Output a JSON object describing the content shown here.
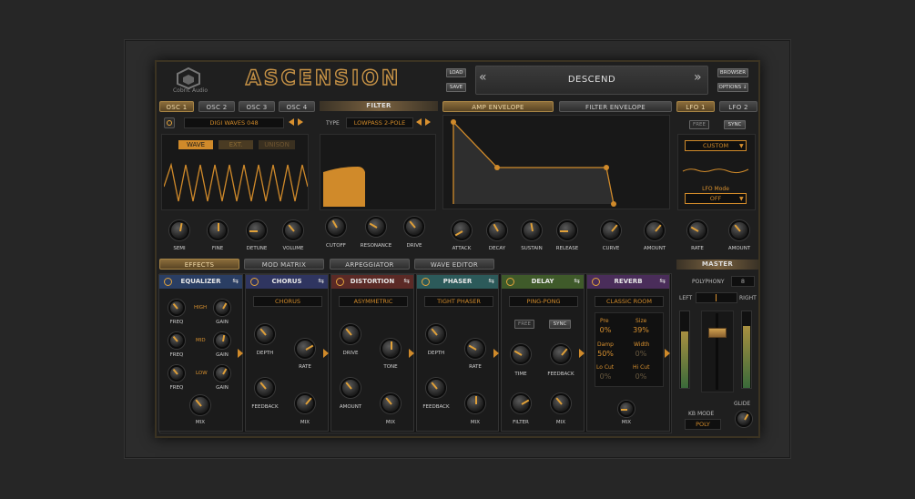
{
  "header": {
    "logo_text": "Cobric Audio",
    "title": "ASCENSION",
    "load": "LOAD",
    "save": "SAVE",
    "prev": "«",
    "next": "»",
    "preset": "DESCEND",
    "browser": "BROWSER",
    "options": "OPTIONS ↓"
  },
  "osc": {
    "tabs": [
      "OSC 1",
      "OSC 2",
      "OSC 3",
      "OSC 4"
    ],
    "waveform_name": "DIGI WAVES 048",
    "modes": [
      "WAVE",
      "EXT.",
      "UNISON"
    ],
    "knobs": [
      "SEMI",
      "FINE",
      "DETUNE",
      "VOLUME"
    ]
  },
  "filter": {
    "title": "FILTER",
    "type_label": "TYPE",
    "type_value": "LOWPASS 2-POLE",
    "knobs": [
      "CUTOFF",
      "RESONANCE",
      "DRIVE"
    ]
  },
  "envelope": {
    "tabs": [
      "AMP ENVELOPE",
      "FILTER ENVELOPE"
    ],
    "knobs": [
      "ATTACK",
      "DECAY",
      "SUSTAIN",
      "RELEASE",
      "CURVE",
      "AMOUNT"
    ]
  },
  "lfo": {
    "tabs": [
      "LFO 1",
      "LFO 2"
    ],
    "free": "FREE",
    "sync": "SYNC",
    "shape": "CUSTOM",
    "mode_label": "LFO Mode",
    "mode_value": "OFF",
    "knobs": [
      "RATE",
      "AMOUNT"
    ]
  },
  "section_tabs": [
    "EFFECTS",
    "MOD MATRIX",
    "ARPEGGIATOR",
    "WAVE EDITOR"
  ],
  "master": {
    "title": "MASTER",
    "polyphony_label": "POLYPHONY",
    "polyphony_value": "8",
    "left": "LEFT",
    "right": "RIGHT",
    "glide": "GLIDE",
    "kb_mode_label": "KB MODE",
    "kb_mode_value": "POLY"
  },
  "effects": {
    "equalizer": {
      "title": "EQUALIZER",
      "bands": [
        "HIGH",
        "MID",
        "LOW"
      ],
      "freq": "FREQ",
      "gain": "GAIN",
      "mix": "MIX"
    },
    "chorus": {
      "title": "CHORUS",
      "preset": "CHORUS",
      "knobs": [
        "DEPTH",
        "RATE",
        "FEEDBACK",
        "MIX"
      ]
    },
    "distortion": {
      "title": "DISTORTION",
      "preset": "ASYMMETRIC",
      "knobs": [
        "DRIVE",
        "TONE",
        "AMOUNT",
        "MIX"
      ]
    },
    "phaser": {
      "title": "PHASER",
      "preset": "TIGHT PHASER",
      "knobs": [
        "DEPTH",
        "RATE",
        "FEEDBACK",
        "MIX"
      ]
    },
    "delay": {
      "title": "DELAY",
      "preset": "PING-PONG",
      "free": "FREE",
      "sync": "SYNC",
      "knobs": [
        "TIME",
        "FEEDBACK",
        "FILTER",
        "MIX"
      ]
    },
    "reverb": {
      "title": "REVERB",
      "preset": "CLASSIC ROOM",
      "params": [
        {
          "label": "Pre",
          "value": "0%"
        },
        {
          "label": "Size",
          "value": "39%"
        },
        {
          "label": "Damp",
          "value": "50%"
        },
        {
          "label": "Width",
          "value": "0%"
        },
        {
          "label": "Lo Cut",
          "value": "0%"
        },
        {
          "label": "Hi Cut",
          "value": "0%"
        }
      ],
      "mix": "MIX"
    }
  },
  "colors": {
    "accent": "#d9912f",
    "eq": "#2a3e63",
    "chorus": "#2f3560",
    "distortion": "#5b2a26",
    "phaser": "#2c5a5a",
    "delay": "#3f5a2a",
    "reverb": "#4a2d5a"
  }
}
